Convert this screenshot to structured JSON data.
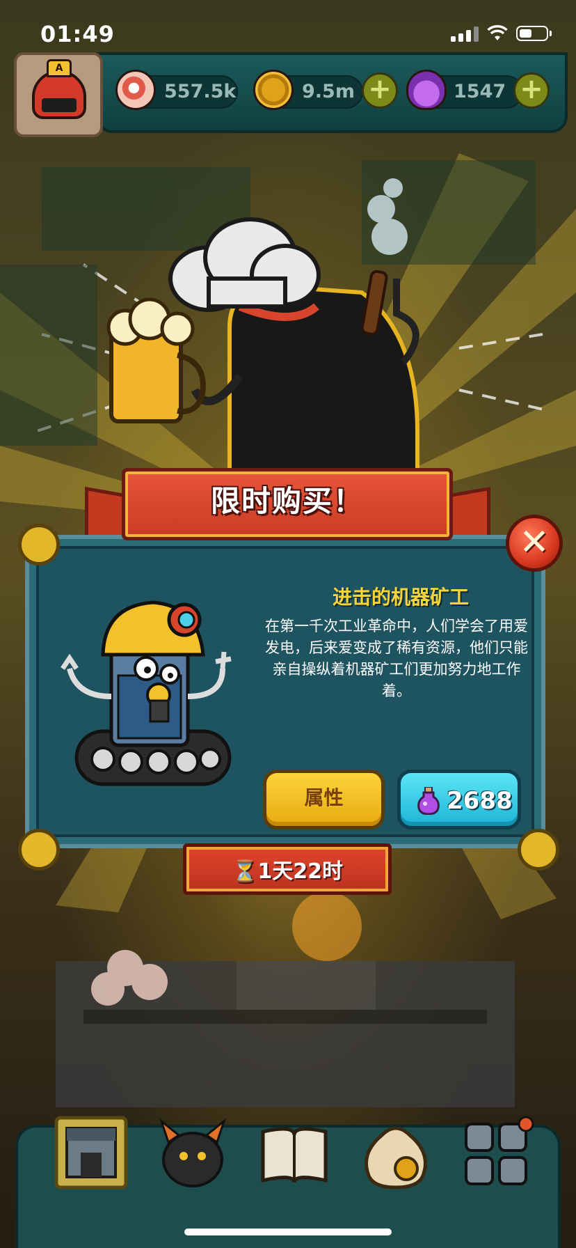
{
  "status_bar": {
    "time": "01:49"
  },
  "hud": {
    "avatar_letter": "A",
    "resources": [
      {
        "icon": "eyeball-icon",
        "value": "557.5k"
      },
      {
        "icon": "gold-coin-icon",
        "value": "9.5m"
      },
      {
        "icon": "purple-potion-icon",
        "value": "1547"
      }
    ]
  },
  "offer": {
    "banner_title": "限时购买！",
    "item_title": "进击的机器矿工",
    "item_description": "在第一千次工业革命中，人们学会了用爱发电，后来爱变成了稀有资源，他们只能亲自操纵着机器矿工们更加努力地工作着。",
    "attributes_button": "属性",
    "price": "2688",
    "price_icon": "purple-potion-icon",
    "timer": "1天22时",
    "timer_icon": "hourglass-icon"
  },
  "bottom_nav": [
    {
      "icon": "castle-icon"
    },
    {
      "icon": "demon-icon"
    },
    {
      "icon": "book-icon"
    },
    {
      "icon": "coin-bag-icon"
    },
    {
      "icon": "grid-menu-icon"
    }
  ],
  "colors": {
    "panel": "#1e5360",
    "banner": "#d84a2f",
    "title_yellow": "#f6d53a",
    "buy_button": "#35cbe6",
    "attr_button": "#f5c22a"
  }
}
